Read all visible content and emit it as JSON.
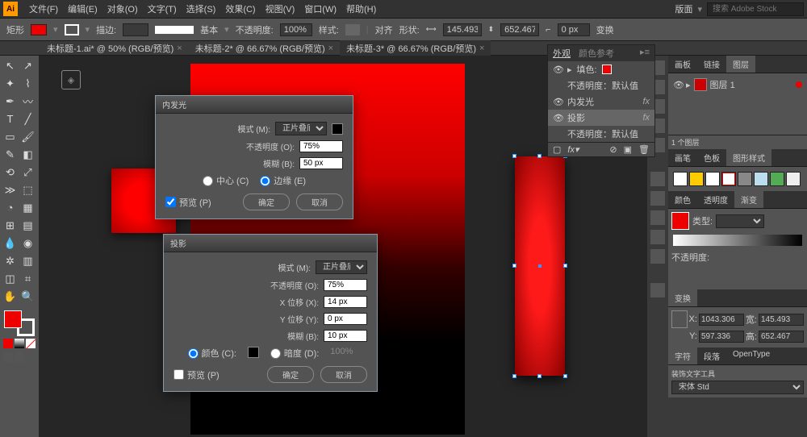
{
  "menu": {
    "items": [
      "文件(F)",
      "编辑(E)",
      "对象(O)",
      "文字(T)",
      "选择(S)",
      "效果(C)",
      "视图(V)",
      "窗口(W)",
      "帮助(H)"
    ],
    "layout_label": "版面",
    "search_placeholder": "搜索 Adobe Stock"
  },
  "options": {
    "shape": "矩形",
    "stroke_label": "描边:",
    "basic": "基本",
    "opacity_label": "不透明度:",
    "opacity": "100%",
    "style_label": "样式:",
    "align_label": "对齐",
    "shape_label2": "形状:",
    "w": "145.493 p",
    "h": "652.467 p",
    "corner": "0 px",
    "transform_btn": "变换"
  },
  "tabs": [
    {
      "label": "未标题-1.ai* @ 50% (RGB/预览)",
      "active": false
    },
    {
      "label": "未标题-2* @ 66.67% (RGB/预览)",
      "active": false
    },
    {
      "label": "未标题-3* @ 66.67% (RGB/预览)",
      "active": true
    }
  ],
  "appearance": {
    "tabs": [
      "外观",
      "颜色参考"
    ],
    "fill_label": "填色:",
    "op_default": "不透明度：默认值",
    "inner_glow": "内发光",
    "drop_shadow": "投影"
  },
  "layers": {
    "tabs": [
      "画板",
      "链接",
      "图层"
    ],
    "layer1": "图层 1",
    "count_label": "1 个图层"
  },
  "swatches": {
    "tabs": [
      "画笔",
      "色板",
      "图形样式"
    ]
  },
  "color": {
    "tabs": [
      "颜色",
      "透明度",
      "渐变"
    ],
    "type_label": "类型:"
  },
  "transform": {
    "tab": "变换",
    "x": "1043.306",
    "y": "597.336",
    "w": "145.493",
    "h": "652.467"
  },
  "char": {
    "tabs": [
      "字符",
      "段落",
      "OpenType"
    ],
    "decorate": "装饰文字工具",
    "font": "宋体 Std"
  },
  "dialog_glow": {
    "title": "内发光",
    "mode_label": "模式 (M):",
    "mode": "正片叠底",
    "opacity_label": "不透明度 (O):",
    "opacity": "75%",
    "blur_label": "模糊 (B):",
    "blur": "50 px",
    "center": "中心 (C)",
    "edge": "边缘 (E)",
    "preview": "预览 (P)",
    "ok": "确定",
    "cancel": "取消"
  },
  "dialog_shadow": {
    "title": "投影",
    "mode_label": "模式 (M):",
    "mode": "正片叠底",
    "opacity_label": "不透明度 (O):",
    "opacity": "75%",
    "x_label": "X 位移 (X):",
    "x": "14 px",
    "y_label": "Y 位移 (Y):",
    "y": "0 px",
    "blur_label": "模糊 (B):",
    "blur": "10 px",
    "color_label": "颜色 (C):",
    "dark_label": "暗度 (D):",
    "dark": "100%",
    "preview": "预览 (P)",
    "ok": "确定",
    "cancel": "取消"
  },
  "opacity_panel_label": "不透明度:"
}
